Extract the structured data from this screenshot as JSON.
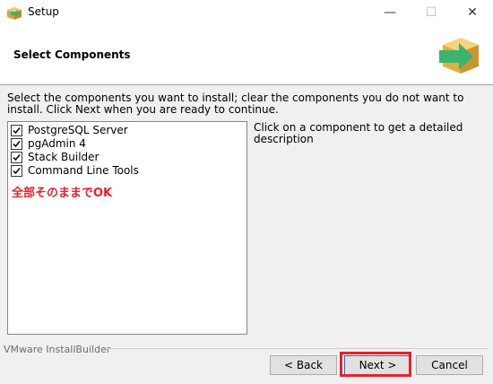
{
  "window": {
    "title": "Setup",
    "minimize_glyph": "—",
    "maximize_glyph": "☐",
    "close_glyph": "✕"
  },
  "header": {
    "title": "Select Components",
    "logo_icon": "installer-box-arrow-icon"
  },
  "instructions": "Select the components you want to install; clear the components you do not want to install. Click Next when you are ready to continue.",
  "components": [
    {
      "label": "PostgreSQL Server",
      "checked": true
    },
    {
      "label": "pgAdmin 4",
      "checked": true
    },
    {
      "label": "Stack Builder",
      "checked": true
    },
    {
      "label": "Command Line Tools",
      "checked": true
    }
  ],
  "annotation": "全部そのままでOK",
  "description": "Click on a component to get a detailed description",
  "footer": {
    "brand": "VMware InstallBuilder"
  },
  "buttons": {
    "back": "< Back",
    "next": "Next >",
    "cancel": "Cancel"
  },
  "colors": {
    "highlight": "#e8202a",
    "logo_green": "#3cb371",
    "logo_box": "#e0b040"
  }
}
